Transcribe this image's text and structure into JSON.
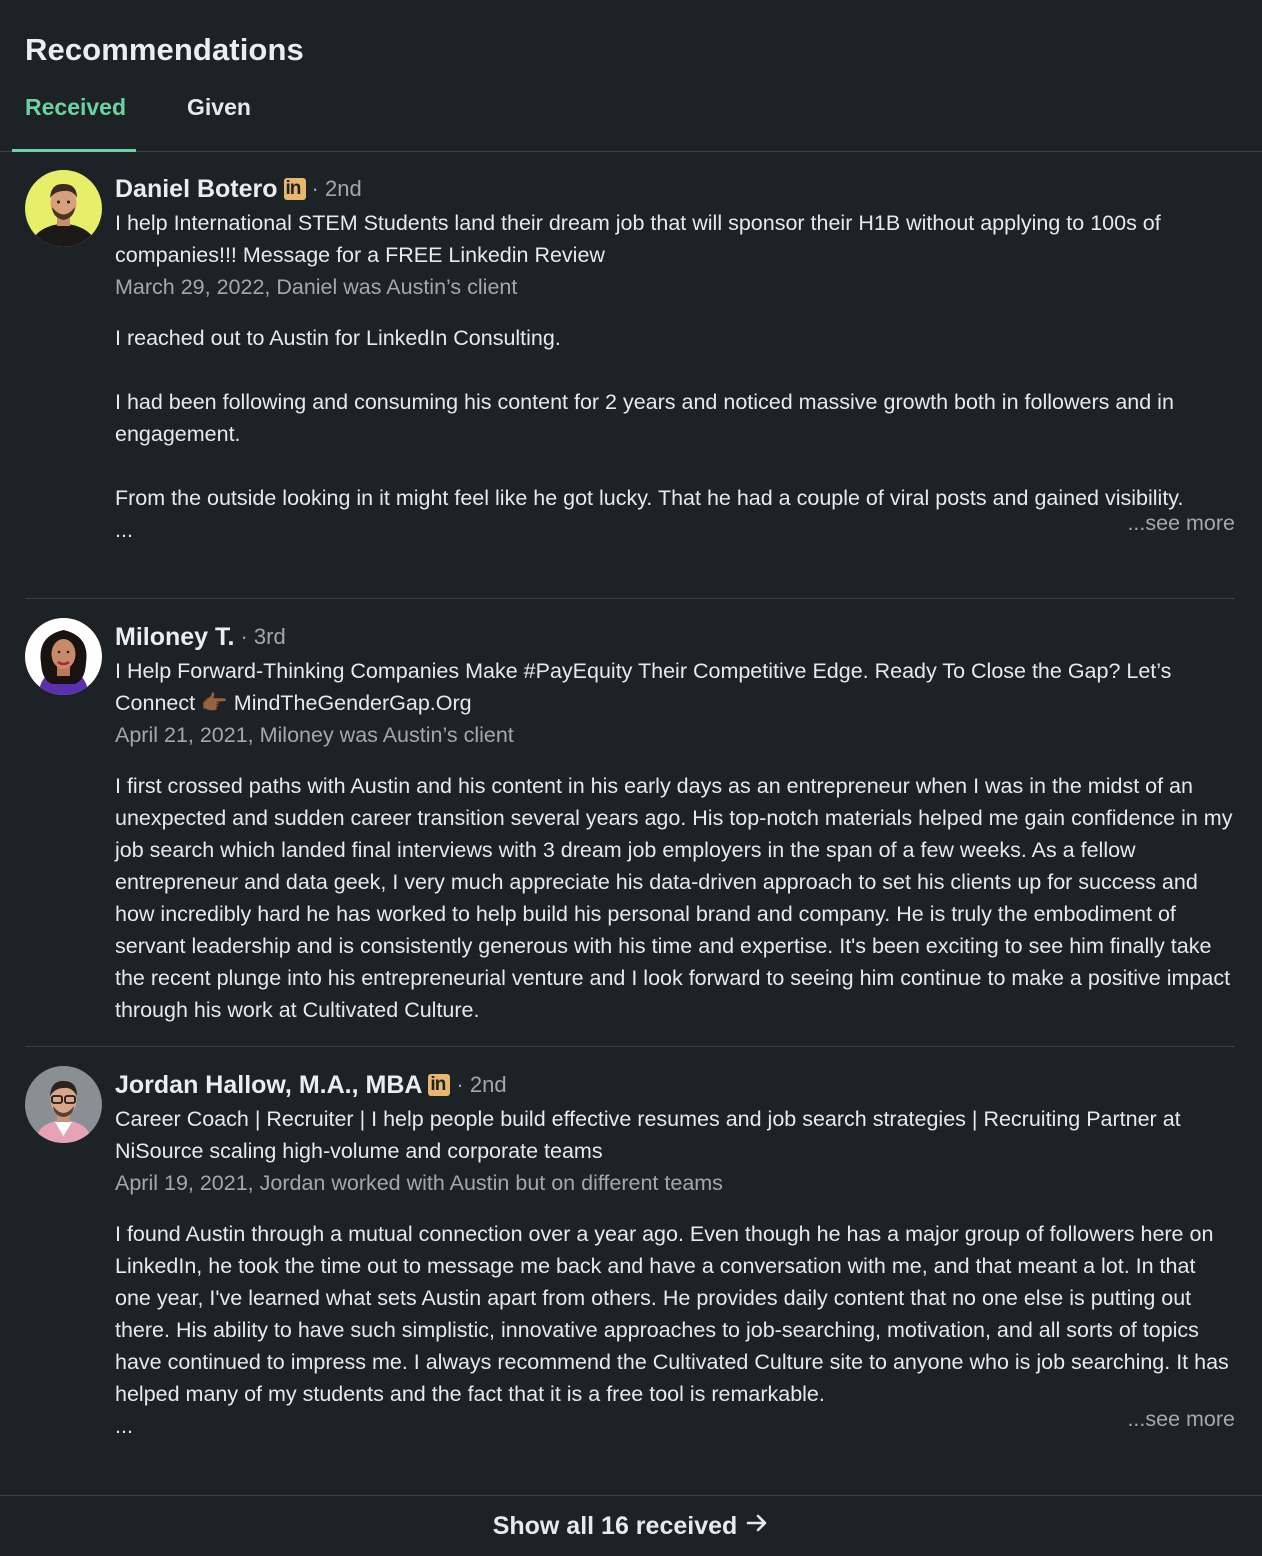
{
  "section": {
    "title": "Recommendations",
    "tabs": [
      {
        "label": "Received",
        "active": true
      },
      {
        "label": "Given",
        "active": false
      }
    ]
  },
  "recommendations": [
    {
      "name": "Daniel Botero",
      "has_linkedin_badge": true,
      "degree": "· 2nd",
      "headline": "I help International STEM Students land their dream job that will sponsor their H1B without applying to 100s of companies!!! Message for a FREE Linkedin Review",
      "meta": "March 29, 2022, Daniel was Austin’s client",
      "paragraphs": [
        "I reached out to Austin for LinkedIn Consulting.",
        "I had been following and consuming his content for 2 years and noticed massive growth both in followers and in engagement.",
        "From the outside looking in it might feel like he got lucky. That he had a couple of viral posts and gained visibility."
      ],
      "ellipsis": "...",
      "see_more": "...see more"
    },
    {
      "name": "Miloney T.",
      "has_linkedin_badge": false,
      "degree": "· 3rd",
      "headline": "I Help Forward-Thinking Companies Make #PayEquity Their Competitive Edge. Ready To Close the Gap? Let’s Connect 👉🏾 MindTheGenderGap.Org",
      "meta": "April 21, 2021, Miloney was Austin’s client",
      "paragraphs": [
        "I first crossed paths with Austin and his content in his early days as an entrepreneur when I was in the midst of an unexpected and sudden career transition several years ago. His top-notch materials helped me gain confidence in my job search which landed final interviews with 3 dream job employers in the span of a few weeks. As a fellow entrepreneur and data geek, I very much appreciate his data-driven approach to set his clients up for success and how incredibly hard he has worked to help build his personal brand and company. He is truly the embodiment of servant leadership and is consistently generous with his time and expertise. It's been exciting to see him finally take the recent plunge into his entrepreneurial venture and I look forward to seeing him continue to make a positive impact through his work at Cultivated Culture."
      ]
    },
    {
      "name": "Jordan Hallow, M.A., MBA",
      "has_linkedin_badge": true,
      "degree": "· 2nd",
      "headline": "Career Coach | Recruiter | I help people build effective resumes and job search strategies | Recruiting Partner at NiSource scaling high-volume and corporate teams",
      "meta": "April 19, 2021, Jordan worked with Austin but on different teams",
      "paragraphs": [
        "I found Austin through a mutual connection over a year ago. Even though he has a major group of followers here on LinkedIn, he took the time out to message me back and have a conversation with me, and that meant a lot. In that one year, I've learned what sets Austin apart from others. He provides daily content that no one else is putting out there. His ability to have such simplistic, innovative approaches to job-searching, motivation, and all sorts of topics have continued to impress me. I always recommend the Cultivated Culture site to anyone who is job searching. It has helped many of my students and the fact that it is a free tool is remarkable."
      ],
      "ellipsis": "...",
      "see_more": "...see more"
    }
  ],
  "badge_text": "in",
  "footer": {
    "show_all": "Show all 16 received",
    "arrow_icon": "arrow-right-icon"
  },
  "colors": {
    "background": "#1d2226",
    "accent": "#6dd2a1",
    "badge": "#e7b86b",
    "divider": "#3a4045"
  }
}
